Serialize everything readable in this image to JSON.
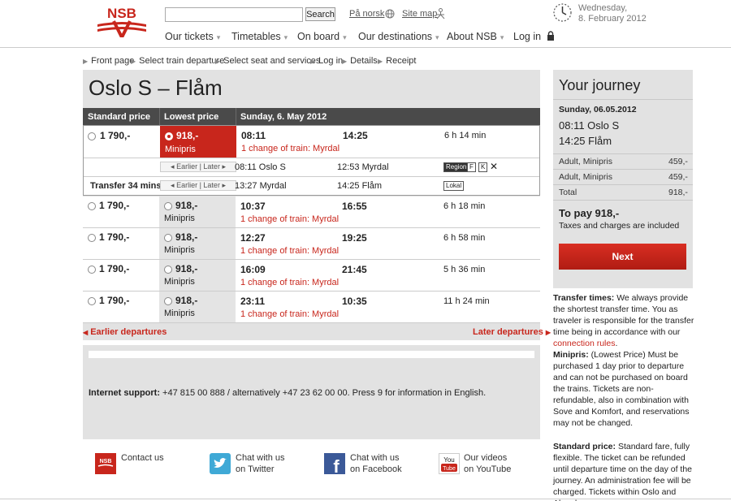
{
  "header": {
    "logo_text": "NSB",
    "search_placeholder": "",
    "search_button": "Search",
    "norsk_link": "På norsk",
    "sitemap_link": "Site map",
    "date_day": "Wednesday,",
    "date_full": "8. February 2012",
    "nav": [
      "Our tickets",
      "Timetables",
      "On board",
      "Our destinations",
      "About NSB",
      "Log in"
    ]
  },
  "breadcrumb": [
    "Front page",
    "Select train departure",
    "Select seat and services",
    "Log in",
    "Details",
    "Receipt"
  ],
  "route_title": "Oslo S – Flåm",
  "table": {
    "col_standard": "Standard price",
    "col_lowest": "Lowest price",
    "col_date": "Sunday, 6. May 2012",
    "rows": [
      {
        "std": "1 790,-",
        "low": "918,-",
        "tariff": "Minipris",
        "dep": "08:11",
        "arr": "14:25",
        "dur": "6 h 14 min",
        "change": "1 change of train: Myrdal"
      },
      {
        "std": "1 790,-",
        "low": "918,-",
        "tariff": "Minipris",
        "dep": "10:37",
        "arr": "16:55",
        "dur": "6 h 18 min",
        "change": "1 change of train: Myrdal"
      },
      {
        "std": "1 790,-",
        "low": "918,-",
        "tariff": "Minipris",
        "dep": "12:27",
        "arr": "19:25",
        "dur": "6 h 58 min",
        "change": "1 change of train: Myrdal"
      },
      {
        "std": "1 790,-",
        "low": "918,-",
        "tariff": "Minipris",
        "dep": "16:09",
        "arr": "21:45",
        "dur": "5 h 36 min",
        "change": "1 change of train: Myrdal"
      },
      {
        "std": "1 790,-",
        "low": "918,-",
        "tariff": "Minipris",
        "dep": "23:11",
        "arr": "10:35",
        "dur": "11 h 24 min",
        "change": "1 change of train: Myrdal"
      }
    ],
    "earlier": "Earlier",
    "later": "Later",
    "leg1": {
      "dep": "08:11 Oslo S",
      "arr": "12:53 Myrdal",
      "tag": "Region",
      "tag2": "F",
      "tag3": "K"
    },
    "transfer": "Transfer 34 mins.",
    "leg2": {
      "dep": "13:27 Myrdal",
      "arr": "14:25 Flåm",
      "tag": "Lokal"
    },
    "earlier_departures": "Earlier departures",
    "later_departures": "Later departures"
  },
  "support": {
    "label": "Internet support:",
    "text": " +47 815 00 888 / alternatively +47 23 62 00 00. Press 9 for information in English."
  },
  "social": [
    {
      "line1": "Contact us",
      "line2": ""
    },
    {
      "line1": "Chat with us",
      "line2": "on Twitter"
    },
    {
      "line1": "Chat with us",
      "line2": "on Facebook"
    },
    {
      "line1": "Our videos",
      "line2": "on YouTube"
    }
  ],
  "journey": {
    "title": "Your journey",
    "date": "Sunday, 06.05.2012",
    "dep": "08:11 Oslo S",
    "arr": "14:25 Flåm",
    "lines": [
      {
        "label": "Adult, Minipris",
        "value": "459,-"
      },
      {
        "label": "Adult, Minipris",
        "value": "459,-"
      },
      {
        "label": "Total",
        "value": "918,-"
      }
    ],
    "pay": "To pay 918,-",
    "pay_note": "Taxes and charges are included",
    "next": "Next"
  },
  "info": {
    "transfer_label": "Transfer times:",
    "transfer_text": " We always provide the shortest transfer time. You as traveler is responsible for the transfer time being in accordance with our ",
    "transfer_link": "connection rules",
    "minipris_label": "Minipris:",
    "minipris_text": " (Lowest Price) Must be purchased 1 day prior to departure and can not be purchased on board the trains. Tickets are non-refundable, also in combination with Sove and Komfort, and reservations may not be changed.",
    "standard_label": "Standard price:",
    "standard_text": " Standard fare, fully flexible. The ticket can be refunded until departure time on the day of the journey. An administration fee will be charged. Tickets within Oslo and Akershus are"
  },
  "colors": {
    "brand_red": "#c8261c",
    "panel_grey": "#e2e2e2",
    "header_dark": "#4a4a4a"
  }
}
